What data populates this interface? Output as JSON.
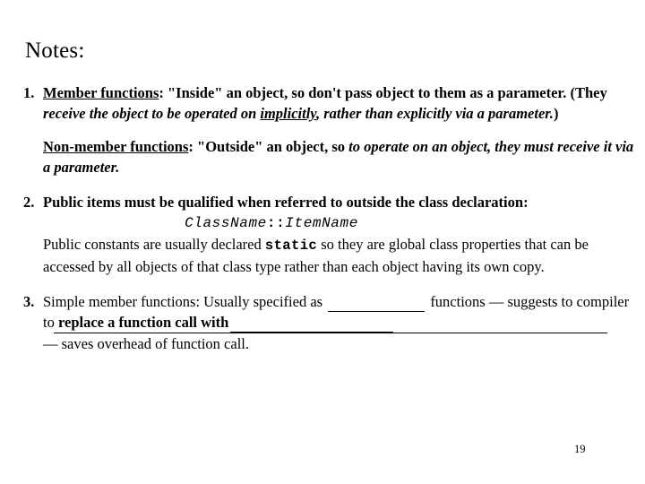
{
  "slide": {
    "title": "Notes:",
    "page_number": "19",
    "background_color": "#ffffff",
    "text_color": "#000000"
  },
  "items": [
    {
      "number": "1.",
      "term": "Member functions",
      "colon": ":",
      "plain_1": " \"Inside\" an object, so don't pass object to them as a parameter.  (They ",
      "italic_1": "receive the object to be operated on ",
      "italic_underlined": "implicitly",
      "italic_2": ", rather than explicitly via a parameter.",
      "plain_2": ")"
    },
    {
      "number": "",
      "term": "Non-member functions",
      "colon": ":",
      "plain_1": " \"Outside\" an object, so ",
      "italic_1": "to operate on an object, they must receive it via a parameter.",
      "plain_2": ""
    },
    {
      "number": "2.",
      "line_1": "Public items must be qualified when referred to outside the class declaration:",
      "code_class": "ClassName",
      "code_scope": "::",
      "code_item": "ItemName",
      "line_2_a": "Public constants are usually declared ",
      "line_2_code": "static",
      "line_2_b": " so they are global class properties that can be accessed by all objects of that class type rather than each object having its own copy."
    },
    {
      "number": "3.",
      "line_a": "Simple member functions:  Usually specified as ",
      "blank_1": "",
      "line_b": " functions — suggests to compiler to ",
      "bold_phrase": "replace a function call with",
      "blank_2": "",
      "blank_3": "",
      "line_c": "— saves overhead of function call."
    }
  ]
}
